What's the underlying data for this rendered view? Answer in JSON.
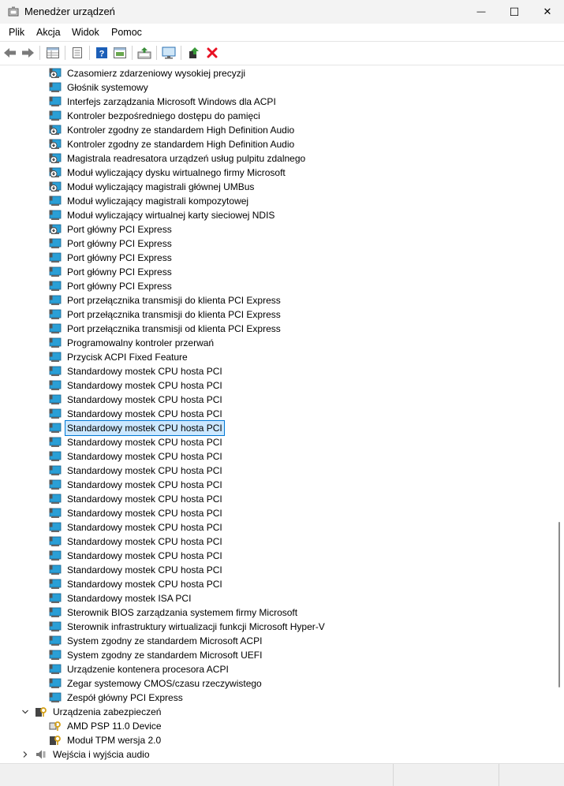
{
  "window": {
    "title": "Menedżer urządzeń",
    "minimize_glyph": "—",
    "maximize_glyph": "☐",
    "close_glyph": "✕"
  },
  "menu": {
    "items": [
      {
        "label": "Plik"
      },
      {
        "label": "Akcja"
      },
      {
        "label": "Widok"
      },
      {
        "label": "Pomoc"
      }
    ]
  },
  "toolbar": {
    "icons": [
      "back-icon",
      "forward-icon",
      "properties-grid-icon",
      "document-icon",
      "help-icon",
      "panel-icon",
      "update-driver-icon",
      "monitor-icon",
      "enable-device-icon",
      "uninstall-icon"
    ]
  },
  "colors": {
    "accent": "#0078d4",
    "selection": "#cce8ff",
    "device_blue": "#2a9fd6",
    "uninstall_red": "#e81123"
  },
  "tree": {
    "system_devices": [
      {
        "label": "Czasomierz zdarzeniowy wysokiej precyzji",
        "icon": "system-device-warning-icon"
      },
      {
        "label": "Głośnik systemowy",
        "icon": "system-device-icon"
      },
      {
        "label": "Interfejs zarządzania Microsoft Windows dla ACPI",
        "icon": "system-device-icon"
      },
      {
        "label": "Kontroler bezpośredniego dostępu do pamięci",
        "icon": "system-device-icon"
      },
      {
        "label": "Kontroler zgodny ze standardem High Definition Audio",
        "icon": "system-device-warning-icon"
      },
      {
        "label": "Kontroler zgodny ze standardem High Definition Audio",
        "icon": "system-device-warning-icon"
      },
      {
        "label": "Magistrala readresatora urządzeń usług pulpitu zdalnego",
        "icon": "system-device-warning-icon"
      },
      {
        "label": "Moduł wyliczający dysku wirtualnego firmy Microsoft",
        "icon": "system-device-warning-icon"
      },
      {
        "label": "Moduł wyliczający magistrali głównej UMBus",
        "icon": "system-device-warning-icon"
      },
      {
        "label": "Moduł wyliczający magistrali kompozytowej",
        "icon": "system-device-icon"
      },
      {
        "label": "Moduł wyliczający wirtualnej karty sieciowej NDIS",
        "icon": "system-device-icon"
      },
      {
        "label": "Port główny PCI Express",
        "icon": "system-device-warning-icon"
      },
      {
        "label": "Port główny PCI Express",
        "icon": "system-device-icon"
      },
      {
        "label": "Port główny PCI Express",
        "icon": "system-device-icon"
      },
      {
        "label": "Port główny PCI Express",
        "icon": "system-device-icon"
      },
      {
        "label": "Port główny PCI Express",
        "icon": "system-device-icon"
      },
      {
        "label": "Port przełącznika transmisji do klienta PCI Express",
        "icon": "system-device-icon"
      },
      {
        "label": "Port przełącznika transmisji do klienta PCI Express",
        "icon": "system-device-icon"
      },
      {
        "label": "Port przełącznika transmisji od klienta PCI Express",
        "icon": "system-device-icon"
      },
      {
        "label": "Programowalny kontroler przerwań",
        "icon": "system-device-icon"
      },
      {
        "label": "Przycisk ACPI Fixed Feature",
        "icon": "system-device-icon"
      },
      {
        "label": "Standardowy mostek CPU hosta PCI",
        "icon": "system-device-icon"
      },
      {
        "label": "Standardowy mostek CPU hosta PCI",
        "icon": "system-device-icon"
      },
      {
        "label": "Standardowy mostek CPU hosta PCI",
        "icon": "system-device-icon"
      },
      {
        "label": "Standardowy mostek CPU hosta PCI",
        "icon": "system-device-icon"
      },
      {
        "label": "Standardowy mostek CPU hosta PCI",
        "icon": "system-device-icon",
        "selected": true
      },
      {
        "label": "Standardowy mostek CPU hosta PCI",
        "icon": "system-device-icon"
      },
      {
        "label": "Standardowy mostek CPU hosta PCI",
        "icon": "system-device-icon"
      },
      {
        "label": "Standardowy mostek CPU hosta PCI",
        "icon": "system-device-icon"
      },
      {
        "label": "Standardowy mostek CPU hosta PCI",
        "icon": "system-device-icon"
      },
      {
        "label": "Standardowy mostek CPU hosta PCI",
        "icon": "system-device-icon"
      },
      {
        "label": "Standardowy mostek CPU hosta PCI",
        "icon": "system-device-icon"
      },
      {
        "label": "Standardowy mostek CPU hosta PCI",
        "icon": "system-device-icon"
      },
      {
        "label": "Standardowy mostek CPU hosta PCI",
        "icon": "system-device-icon"
      },
      {
        "label": "Standardowy mostek CPU hosta PCI",
        "icon": "system-device-icon"
      },
      {
        "label": "Standardowy mostek CPU hosta PCI",
        "icon": "system-device-icon"
      },
      {
        "label": "Standardowy mostek CPU hosta PCI",
        "icon": "system-device-icon"
      },
      {
        "label": "Standardowy mostek ISA PCI",
        "icon": "system-device-icon"
      },
      {
        "label": "Sterownik BIOS zarządzania systemem firmy Microsoft",
        "icon": "system-device-icon"
      },
      {
        "label": "Sterownik infrastruktury wirtualizacji funkcji Microsoft Hyper-V",
        "icon": "system-device-icon"
      },
      {
        "label": "System zgodny ze standardem Microsoft ACPI",
        "icon": "system-device-icon"
      },
      {
        "label": "System zgodny ze standardem Microsoft UEFI",
        "icon": "system-device-icon"
      },
      {
        "label": "Urządzenie kontenera procesora ACPI",
        "icon": "system-device-icon"
      },
      {
        "label": "Zegar systemowy CMOS/czasu rzeczywistego",
        "icon": "system-device-icon"
      },
      {
        "label": "Zespół główny PCI Express",
        "icon": "system-device-icon"
      }
    ],
    "security_category": {
      "label": "Urządzenia zabezpieczeń",
      "icon": "security-device-icon",
      "expanded": true
    },
    "security_devices": [
      {
        "label": "AMD PSP 11.0 Device",
        "icon": "security-chip-icon"
      },
      {
        "label": "Moduł TPM wersja 2.0",
        "icon": "security-device-icon"
      }
    ],
    "audio_category": {
      "label": "Wejścia i wyjścia audio",
      "icon": "speaker-icon",
      "expanded": false
    }
  }
}
